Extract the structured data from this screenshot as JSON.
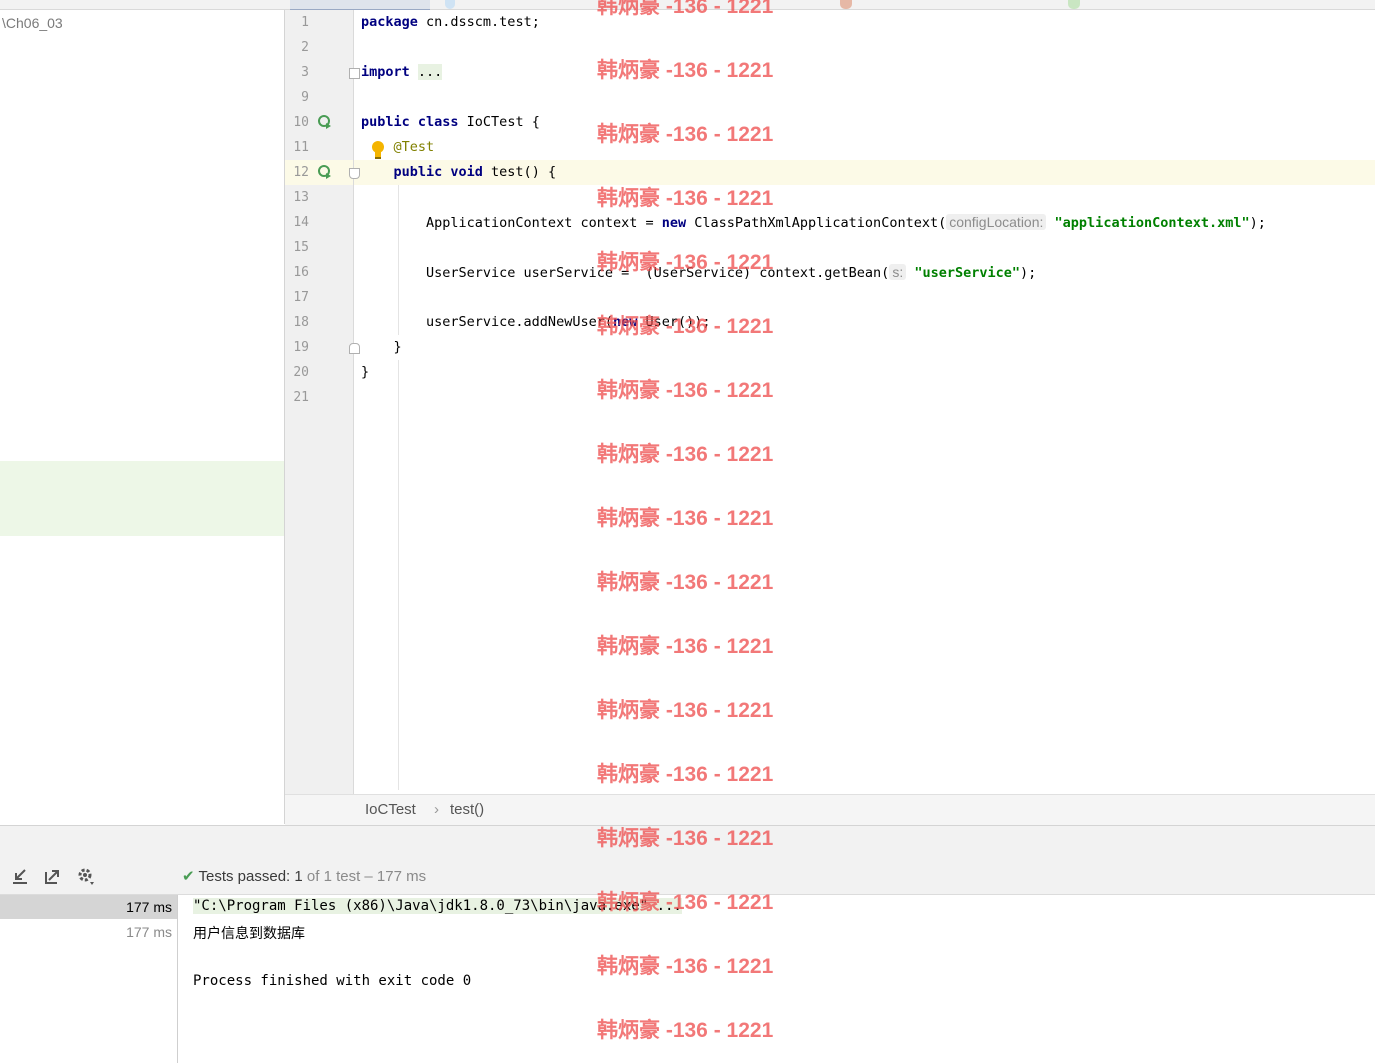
{
  "project": {
    "path": "\\Ch06_03"
  },
  "editor": {
    "lines": [
      {
        "num": "1",
        "parts": [
          {
            "t": "package",
            "c": "kw"
          },
          {
            "t": " cn.dsscm.test;",
            "c": ""
          }
        ]
      },
      {
        "num": "2",
        "parts": []
      },
      {
        "num": "3",
        "parts": [
          {
            "t": "import",
            "c": "kw"
          },
          {
            "t": " ",
            "c": ""
          },
          {
            "t": "...",
            "c": "fold"
          }
        ]
      },
      {
        "num": "9",
        "parts": []
      },
      {
        "num": "10",
        "parts": [
          {
            "t": "public class",
            "c": "kw"
          },
          {
            "t": " IoCTest {",
            "c": ""
          }
        ]
      },
      {
        "num": "11",
        "parts": [
          {
            "t": "    ",
            "c": ""
          },
          {
            "t": "@Test",
            "c": "ann"
          }
        ]
      },
      {
        "num": "12",
        "parts": [
          {
            "t": "    ",
            "c": ""
          },
          {
            "t": "public void",
            "c": "kw"
          },
          {
            "t": " test() {",
            "c": ""
          }
        ]
      },
      {
        "num": "13",
        "parts": []
      },
      {
        "num": "14",
        "parts": [
          {
            "t": "        ApplicationContext context = ",
            "c": ""
          },
          {
            "t": "new",
            "c": "kw"
          },
          {
            "t": " ClassPathXmlApplicationContext(",
            "c": ""
          },
          {
            "t": "configLocation:",
            "c": "hint"
          },
          {
            "t": " ",
            "c": ""
          },
          {
            "t": "\"applicationContext.xml\"",
            "c": "str"
          },
          {
            "t": ");",
            "c": ""
          }
        ]
      },
      {
        "num": "15",
        "parts": []
      },
      {
        "num": "16",
        "parts": [
          {
            "t": "        UserService userService =  (UserService) context.getBean(",
            "c": ""
          },
          {
            "t": "s:",
            "c": "hint"
          },
          {
            "t": " ",
            "c": ""
          },
          {
            "t": "\"userService\"",
            "c": "str"
          },
          {
            "t": ");",
            "c": ""
          }
        ]
      },
      {
        "num": "17",
        "parts": []
      },
      {
        "num": "18",
        "parts": [
          {
            "t": "        userService.addNewUser(",
            "c": ""
          },
          {
            "t": "new",
            "c": "kw"
          },
          {
            "t": " User());",
            "c": ""
          }
        ]
      },
      {
        "num": "19",
        "parts": [
          {
            "t": "    }",
            "c": ""
          }
        ]
      },
      {
        "num": "20",
        "parts": [
          {
            "t": "}",
            "c": ""
          }
        ]
      },
      {
        "num": "21",
        "parts": []
      }
    ]
  },
  "breadcrumb": {
    "class": "IoCTest",
    "separator": "›",
    "method": "test()"
  },
  "run": {
    "status_check": "✔",
    "status_main": "Tests passed: 1",
    "status_rest": " of 1 test – 177 ms",
    "tree": [
      {
        "time": "177 ms"
      },
      {
        "time": "177 ms"
      }
    ],
    "console": [
      {
        "text": "\"C:\\Program Files (x86)\\Java\\jdk1.8.0_73\\bin\\java.exe\" ...",
        "color": "#1a7d3c"
      },
      {
        "text": "用户信息到数据库",
        "color": "#000000"
      },
      {
        "text": "",
        "color": "#000000"
      },
      {
        "text": "Process finished with exit code 0",
        "color": "#1e2f9e"
      }
    ]
  },
  "watermark": "韩炳豪 -136 - 1221",
  "colors": {
    "keyword": "#000080",
    "string": "#008000",
    "annotation": "#808000",
    "run_green": "#499c54",
    "watermark": "#ee4c4c"
  }
}
